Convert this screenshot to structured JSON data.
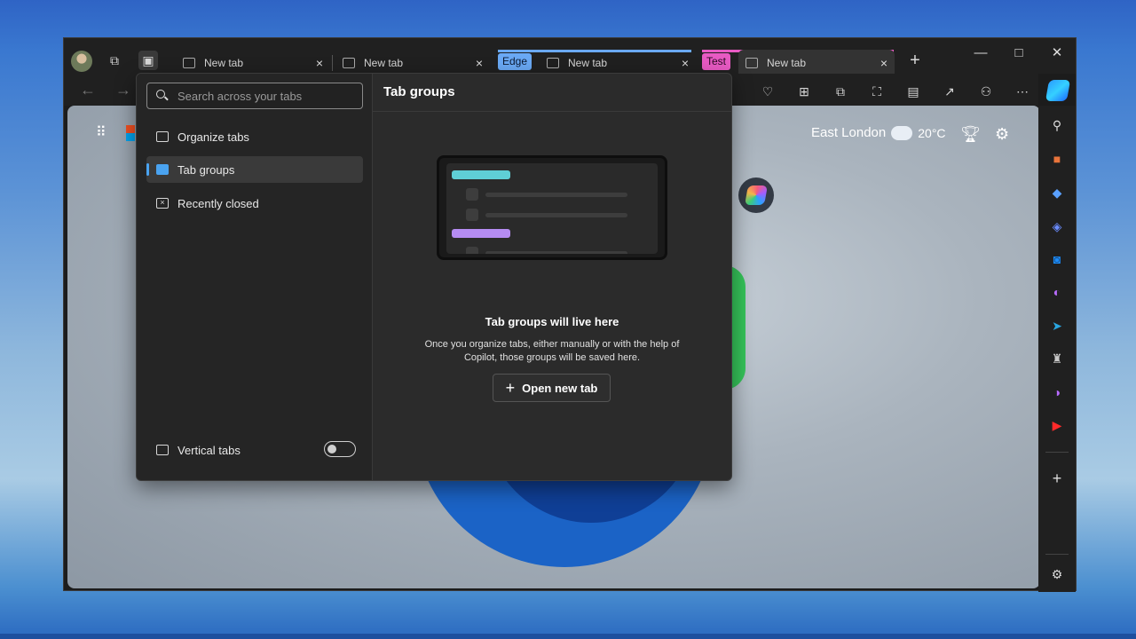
{
  "titlebar": {
    "tabs": [
      {
        "label": "New tab"
      },
      {
        "label": "New tab"
      },
      {
        "label": "New tab"
      },
      {
        "label": "New tab"
      }
    ],
    "groups": [
      {
        "label": "Edge",
        "color": "#6aa9f5"
      },
      {
        "label": "Test",
        "color": "#e85ac3"
      }
    ],
    "close_glyph": "×",
    "new_tab_glyph": "+",
    "window_controls": {
      "minimize": "—",
      "maximize": "□",
      "close": "✕"
    }
  },
  "weather": {
    "location": "East London",
    "temperature": "20°C"
  },
  "panel": {
    "search_placeholder": "Search across your tabs",
    "menu": [
      {
        "label": "Organize tabs",
        "icon": "organize-icon"
      },
      {
        "label": "Tab groups",
        "icon": "tab-groups-icon",
        "active": true
      },
      {
        "label": "Recently closed",
        "icon": "recently-closed-icon"
      }
    ],
    "vertical_tabs_label": "Vertical tabs",
    "vertical_tabs_enabled": false,
    "header": "Tab groups",
    "empty_title": "Tab groups will live here",
    "empty_description": "Once you organize tabs, either manually or with the help of Copilot, those groups will be saved here.",
    "open_button_label": "Open new tab"
  },
  "colors": {
    "accent": "#4aa3f0",
    "illustration_teal": "#5fcfd6",
    "illustration_purple": "#b58cf2"
  }
}
